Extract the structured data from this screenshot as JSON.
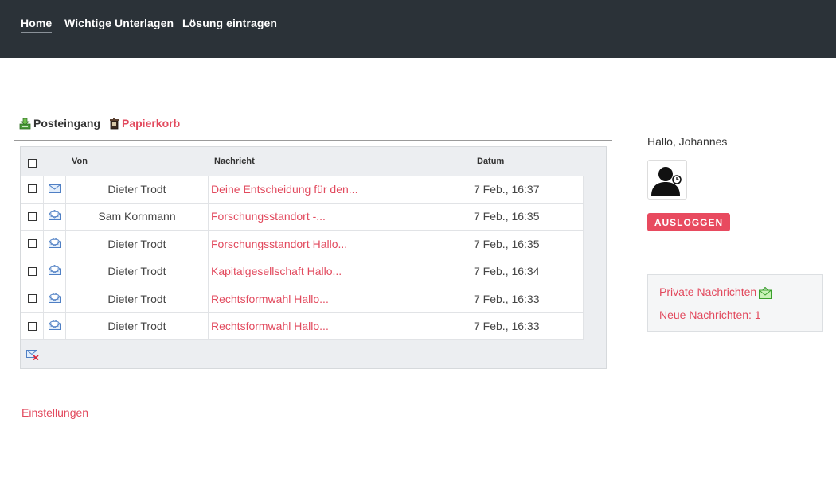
{
  "navbar": {
    "items": [
      {
        "label": "Home",
        "active": true
      },
      {
        "label": "Wichtige Unterlagen",
        "active": false
      },
      {
        "label": "Lösung eintragen",
        "active": false
      }
    ]
  },
  "folders": {
    "inbox_label": "Posteingang",
    "trash_label": "Papierkorb"
  },
  "table": {
    "headers": {
      "from": "Von",
      "message": "Nachricht",
      "date": "Datum"
    },
    "rows": [
      {
        "from": "Dieter Trodt",
        "message": "Deine Entscheidung für den...",
        "date": "7 Feb., 16:37",
        "read": false
      },
      {
        "from": "Sam Kornmann",
        "message": "Forschungsstandort -...",
        "date": "7 Feb., 16:35",
        "read": true
      },
      {
        "from": "Dieter Trodt",
        "message": "Forschungsstandort Hallo...",
        "date": "7 Feb., 16:35",
        "read": true
      },
      {
        "from": "Dieter Trodt",
        "message": "Kapitalgesellschaft Hallo...",
        "date": "7 Feb., 16:34",
        "read": true
      },
      {
        "from": "Dieter Trodt",
        "message": "Rechtsformwahl Hallo...",
        "date": "7 Feb., 16:33",
        "read": true
      },
      {
        "from": "Dieter Trodt",
        "message": "Rechtsformwahl Hallo...",
        "date": "7 Feb., 16:33",
        "read": true
      }
    ]
  },
  "settings_link": "Einstellungen",
  "user": {
    "greeting": "Hallo, Johannes",
    "logout_label": "AUSLOGGEN"
  },
  "pm_box": {
    "title": "Private Nachrichten",
    "new_messages": "Neue Nachrichten: 1"
  },
  "icons": {
    "inbox": "inbox-tray-icon",
    "trash": "trash-bin-icon",
    "unread_mail": "envelope-closed-icon",
    "read_mail": "envelope-open-icon",
    "delete_mail": "envelope-delete-icon",
    "new_mail": "new-mail-icon",
    "avatar": "user-silhouette-icon"
  },
  "colors": {
    "navbar": "#2b3238",
    "accent": "#e24a5e",
    "logout_button": "#e84a5f"
  }
}
